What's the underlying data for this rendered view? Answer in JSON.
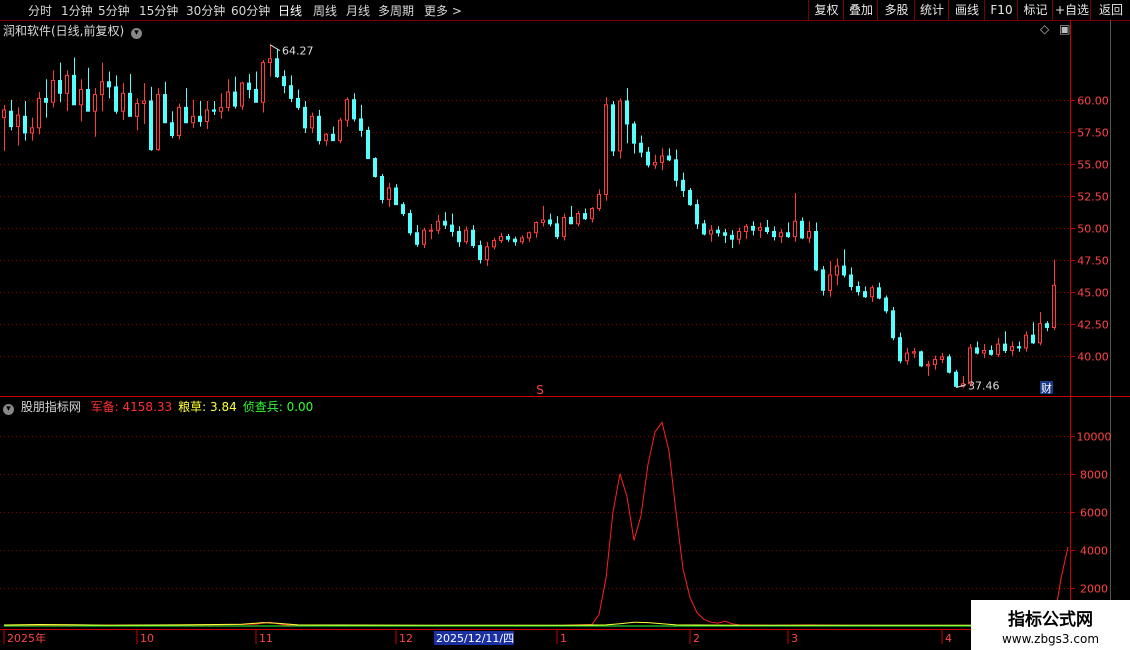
{
  "toolbar": {
    "periods": [
      "分时",
      "1分钟",
      "5分钟",
      "15分钟",
      "30分钟",
      "60分钟",
      "日线",
      "周线",
      "月线",
      "多周期",
      "更多"
    ],
    "active_period": "日线",
    "right_buttons": [
      "复权",
      "叠加",
      "多股",
      "统计",
      "画线",
      "F10",
      "标记",
      "+自选",
      "返回"
    ]
  },
  "chart_title": "润和软件(日线,前复权)",
  "indicator": {
    "name": "股朋指标网",
    "labels": [
      {
        "text": "军备: 4158.33",
        "color": "#ff3030"
      },
      {
        "text": "粮草: 3.84",
        "color": "#ffff3c"
      },
      {
        "text": "侦查兵: 0.00",
        "color": "#30ff30"
      }
    ]
  },
  "markers": {
    "high_label": "64.27",
    "low_label": "37.46",
    "s_mark": "S",
    "cai_mark": "财"
  },
  "watermark": {
    "line1": "指标公式网",
    "line2": "www.zbgs3.com"
  },
  "colors": {
    "up": "#ff3b3b",
    "down": "#54ffff",
    "grid": "#8a0000",
    "axis": "#cc0000",
    "indicator": "#ff2020"
  },
  "chart_data": [
    {
      "type": "candlestick",
      "title": "润和软件(日线,前复权)",
      "y_ticks": [
        40.0,
        42.5,
        45.0,
        47.5,
        50.0,
        52.5,
        55.0,
        57.5,
        60.0
      ],
      "ylim": [
        37.0,
        64.9
      ],
      "x_ticks": [
        {
          "label": "2025年",
          "index": 0
        },
        {
          "label": "10",
          "index": 19
        },
        {
          "label": "11",
          "index": 36
        },
        {
          "label": "12",
          "index": 56
        },
        {
          "label": "2025/12/11/四",
          "index": 64
        },
        {
          "label": "1",
          "index": 79
        },
        {
          "label": "2",
          "index": 98
        },
        {
          "label": "3",
          "index": 112
        },
        {
          "label": "4",
          "index": 134
        }
      ],
      "ohlc": [
        [
          58.6,
          59.6,
          56.0,
          59.2
        ],
        [
          59.1,
          60.0,
          57.6,
          57.9
        ],
        [
          57.9,
          59.4,
          56.4,
          58.8
        ],
        [
          58.7,
          59.9,
          56.8,
          57.4
        ],
        [
          57.4,
          58.6,
          56.8,
          57.8
        ],
        [
          57.8,
          60.6,
          57.3,
          60.1
        ],
        [
          60.1,
          61.6,
          58.6,
          59.8
        ],
        [
          59.8,
          62.3,
          59.4,
          61.5
        ],
        [
          61.5,
          62.9,
          59.8,
          60.5
        ],
        [
          60.5,
          62.3,
          59.1,
          61.9
        ],
        [
          61.9,
          63.3,
          59.8,
          59.6
        ],
        [
          59.6,
          61.6,
          58.3,
          60.8
        ],
        [
          60.8,
          62.5,
          59.6,
          59.1
        ],
        [
          59.1,
          60.9,
          57.1,
          60.4
        ],
        [
          60.4,
          62.9,
          59.1,
          61.4
        ],
        [
          61.4,
          62.2,
          60.1,
          61.0
        ],
        [
          61.0,
          61.9,
          58.9,
          59.1
        ],
        [
          59.1,
          61.3,
          58.4,
          60.5
        ],
        [
          60.5,
          62.0,
          59.3,
          58.7
        ],
        [
          58.7,
          60.1,
          57.6,
          59.7
        ],
        [
          59.7,
          61.3,
          58.1,
          59.9
        ],
        [
          59.9,
          61.0,
          56.0,
          56.1
        ],
        [
          56.1,
          60.9,
          56.0,
          60.4
        ],
        [
          60.4,
          61.4,
          58.6,
          58.2
        ],
        [
          58.2,
          59.1,
          57.0,
          57.2
        ],
        [
          57.2,
          59.7,
          56.9,
          59.4
        ],
        [
          59.4,
          60.9,
          58.6,
          58.2
        ],
        [
          58.2,
          60.0,
          57.8,
          58.7
        ],
        [
          58.7,
          59.9,
          57.9,
          58.3
        ],
        [
          58.3,
          59.9,
          57.7,
          59.2
        ],
        [
          59.2,
          59.9,
          58.8,
          59.1
        ],
        [
          59.1,
          60.5,
          58.5,
          59.4
        ],
        [
          59.4,
          61.6,
          59.1,
          60.6
        ],
        [
          60.6,
          61.8,
          59.3,
          59.5
        ],
        [
          59.5,
          61.4,
          59.2,
          61.3
        ],
        [
          61.3,
          62.0,
          60.1,
          60.8
        ],
        [
          60.8,
          62.2,
          60.1,
          59.8
        ],
        [
          59.8,
          63.1,
          59.0,
          62.9
        ],
        [
          62.9,
          64.3,
          61.8,
          63.2
        ],
        [
          63.2,
          64.0,
          61.7,
          61.8
        ],
        [
          61.8,
          62.3,
          60.5,
          61.1
        ],
        [
          61.1,
          61.9,
          59.8,
          60.1
        ],
        [
          60.1,
          60.8,
          59.2,
          59.4
        ],
        [
          59.4,
          59.9,
          57.4,
          57.8
        ],
        [
          57.8,
          59.0,
          57.4,
          58.7
        ],
        [
          58.7,
          59.2,
          56.5,
          56.8
        ],
        [
          56.8,
          57.4,
          56.4,
          57.3
        ],
        [
          57.3,
          57.9,
          56.8,
          56.8
        ],
        [
          56.8,
          58.6,
          56.6,
          58.4
        ],
        [
          58.4,
          60.2,
          57.9,
          60.0
        ],
        [
          60.0,
          60.5,
          58.3,
          58.5
        ],
        [
          58.5,
          59.6,
          57.1,
          57.6
        ],
        [
          57.6,
          57.9,
          55.4,
          55.4
        ],
        [
          55.4,
          55.5,
          53.9,
          54.0
        ],
        [
          54.0,
          54.2,
          51.9,
          52.2
        ],
        [
          52.2,
          53.5,
          51.6,
          53.1
        ],
        [
          53.1,
          53.4,
          51.8,
          51.8
        ],
        [
          51.8,
          52.0,
          50.9,
          51.1
        ],
        [
          51.1,
          51.4,
          49.4,
          49.6
        ],
        [
          49.6,
          50.2,
          48.5,
          48.7
        ],
        [
          48.7,
          50.0,
          48.4,
          49.8
        ],
        [
          49.8,
          50.3,
          49.1,
          49.8
        ],
        [
          49.8,
          51.0,
          49.5,
          50.5
        ],
        [
          50.5,
          51.2,
          49.9,
          50.2
        ],
        [
          50.2,
          51.1,
          49.3,
          49.7
        ],
        [
          49.7,
          50.1,
          48.5,
          48.9
        ],
        [
          48.9,
          50.1,
          48.7,
          49.8
        ],
        [
          49.8,
          50.2,
          48.4,
          48.6
        ],
        [
          48.6,
          49.0,
          47.2,
          47.5
        ],
        [
          47.5,
          48.9,
          47.0,
          48.5
        ],
        [
          48.5,
          49.2,
          48.3,
          49.0
        ],
        [
          49.0,
          49.6,
          48.8,
          49.3
        ],
        [
          49.3,
          49.5,
          48.9,
          49.1
        ],
        [
          49.1,
          49.3,
          48.6,
          48.9
        ],
        [
          48.9,
          49.4,
          48.7,
          49.2
        ],
        [
          49.2,
          49.7,
          48.9,
          49.6
        ],
        [
          49.6,
          50.5,
          49.2,
          50.4
        ],
        [
          50.4,
          51.7,
          50.1,
          50.6
        ],
        [
          50.6,
          51.1,
          50.1,
          50.3
        ],
        [
          50.3,
          50.9,
          49.1,
          49.3
        ],
        [
          49.3,
          51.1,
          49.0,
          50.8
        ],
        [
          50.8,
          51.7,
          50.3,
          50.3
        ],
        [
          50.3,
          51.3,
          50.1,
          51.1
        ],
        [
          51.1,
          51.5,
          50.6,
          50.7
        ],
        [
          50.7,
          51.6,
          50.4,
          51.5
        ],
        [
          51.5,
          53.0,
          51.3,
          52.6
        ],
        [
          52.6,
          60.2,
          52.1,
          59.6
        ],
        [
          59.6,
          59.9,
          55.6,
          56.0
        ],
        [
          56.0,
          60.1,
          55.4,
          59.9
        ],
        [
          59.9,
          60.9,
          56.6,
          58.1
        ],
        [
          58.1,
          58.3,
          55.8,
          56.6
        ],
        [
          56.6,
          57.2,
          55.5,
          55.9
        ],
        [
          55.9,
          56.3,
          54.7,
          54.9
        ],
        [
          54.9,
          55.7,
          54.6,
          55.1
        ],
        [
          55.1,
          56.2,
          54.5,
          55.6
        ],
        [
          55.6,
          56.2,
          55.2,
          55.3
        ],
        [
          55.3,
          56.1,
          53.2,
          53.7
        ],
        [
          53.7,
          54.3,
          52.4,
          52.9
        ],
        [
          52.9,
          53.1,
          51.7,
          51.8
        ],
        [
          51.8,
          52.2,
          49.9,
          50.3
        ],
        [
          50.3,
          50.6,
          49.4,
          49.5
        ],
        [
          49.5,
          50.2,
          48.9,
          49.8
        ],
        [
          49.8,
          50.1,
          49.3,
          49.6
        ],
        [
          49.6,
          49.9,
          48.8,
          49.4
        ],
        [
          49.4,
          49.8,
          48.4,
          49.1
        ],
        [
          49.1,
          50.0,
          48.7,
          49.7
        ],
        [
          49.7,
          50.3,
          49.1,
          50.1
        ],
        [
          50.1,
          50.5,
          49.4,
          49.8
        ],
        [
          49.8,
          50.4,
          49.2,
          50.0
        ],
        [
          50.0,
          50.6,
          49.5,
          49.7
        ],
        [
          49.7,
          50.1,
          49.0,
          49.3
        ],
        [
          49.3,
          49.9,
          48.8,
          49.6
        ],
        [
          49.6,
          50.4,
          49.2,
          49.3
        ],
        [
          49.3,
          52.7,
          48.9,
          50.5
        ],
        [
          50.5,
          50.8,
          49.1,
          49.2
        ],
        [
          49.2,
          50.5,
          48.8,
          49.7
        ],
        [
          49.7,
          50.4,
          46.6,
          46.7
        ],
        [
          46.7,
          47.0,
          44.7,
          45.1
        ],
        [
          45.1,
          47.4,
          44.6,
          46.3
        ],
        [
          46.3,
          47.6,
          45.5,
          47.0
        ],
        [
          47.0,
          48.3,
          46.1,
          46.3
        ],
        [
          46.3,
          46.9,
          45.1,
          45.4
        ],
        [
          45.4,
          45.8,
          44.7,
          45.0
        ],
        [
          45.0,
          45.4,
          44.5,
          44.6
        ],
        [
          44.6,
          45.5,
          44.2,
          45.3
        ],
        [
          45.3,
          45.7,
          44.4,
          44.5
        ],
        [
          44.5,
          44.7,
          43.3,
          43.5
        ],
        [
          43.5,
          43.8,
          41.2,
          41.4
        ],
        [
          41.4,
          41.8,
          39.4,
          39.6
        ],
        [
          39.6,
          40.6,
          39.3,
          40.2
        ],
        [
          40.2,
          40.6,
          39.8,
          40.3
        ],
        [
          40.3,
          40.4,
          39.1,
          39.2
        ],
        [
          39.2,
          39.6,
          38.4,
          39.3
        ],
        [
          39.3,
          40.0,
          38.9,
          39.7
        ],
        [
          39.7,
          40.2,
          39.4,
          39.9
        ],
        [
          39.9,
          40.1,
          38.6,
          38.7
        ],
        [
          38.7,
          38.9,
          37.5,
          37.6
        ],
        [
          37.6,
          38.4,
          37.5,
          37.8
        ],
        [
          37.8,
          40.9,
          37.6,
          40.6
        ],
        [
          40.6,
          41.1,
          40.1,
          40.2
        ],
        [
          40.2,
          40.9,
          39.8,
          40.4
        ],
        [
          40.4,
          40.8,
          40.0,
          40.1
        ],
        [
          40.1,
          41.4,
          39.9,
          40.9
        ],
        [
          40.9,
          41.9,
          40.2,
          40.4
        ],
        [
          40.4,
          41.1,
          40.0,
          40.7
        ],
        [
          40.7,
          41.1,
          40.3,
          40.6
        ],
        [
          40.6,
          41.9,
          40.3,
          41.6
        ],
        [
          41.6,
          42.6,
          40.9,
          41.0
        ],
        [
          41.0,
          43.4,
          40.8,
          42.5
        ],
        [
          42.5,
          42.7,
          41.9,
          42.2
        ],
        [
          42.2,
          47.5,
          42.0,
          45.5
        ]
      ]
    },
    {
      "type": "line",
      "title": "股朋指标网",
      "y_ticks": [
        2000,
        4000,
        6000,
        8000,
        10000
      ],
      "ylim": [
        0,
        11300
      ],
      "series": [
        {
          "name": "军备",
          "color": "#ff2020",
          "points": [
            [
              0,
              30
            ],
            [
              10,
              40
            ],
            [
              20,
              50
            ],
            [
              30,
              60
            ],
            [
              36,
              100
            ],
            [
              38,
              200
            ],
            [
              40,
              60
            ],
            [
              50,
              40
            ],
            [
              60,
              30
            ],
            [
              70,
              30
            ],
            [
              80,
              40
            ],
            [
              84,
              80
            ],
            [
              85,
              600
            ],
            [
              86,
              2500
            ],
            [
              87,
              6000
            ],
            [
              88,
              8000
            ],
            [
              89,
              6800
            ],
            [
              90,
              4500
            ],
            [
              91,
              5800
            ],
            [
              92,
              8500
            ],
            [
              93,
              10200
            ],
            [
              94,
              10700
            ],
            [
              95,
              9200
            ],
            [
              96,
              6000
            ],
            [
              97,
              3000
            ],
            [
              98,
              1500
            ],
            [
              99,
              700
            ],
            [
              100,
              350
            ],
            [
              101,
              200
            ],
            [
              102,
              150
            ],
            [
              103,
              250
            ],
            [
              104,
              120
            ],
            [
              105,
              60
            ],
            [
              110,
              40
            ],
            [
              115,
              60
            ],
            [
              120,
              40
            ],
            [
              130,
              30
            ],
            [
              140,
              30
            ],
            [
              148,
              40
            ],
            [
              150,
              250
            ],
            [
              151,
              2500
            ],
            [
              152,
              4158.33
            ]
          ]
        },
        {
          "name": "粮草",
          "color": "#ffff3c",
          "points": [
            [
              0,
              50
            ],
            [
              5,
              80
            ],
            [
              10,
              70
            ],
            [
              15,
              40
            ],
            [
              25,
              60
            ],
            [
              34,
              90
            ],
            [
              37,
              180
            ],
            [
              39,
              140
            ],
            [
              42,
              60
            ],
            [
              60,
              40
            ],
            [
              80,
              40
            ],
            [
              86,
              60
            ],
            [
              88,
              120
            ],
            [
              90,
              200
            ],
            [
              92,
              180
            ],
            [
              94,
              120
            ],
            [
              96,
              60
            ],
            [
              105,
              40
            ],
            [
              120,
              40
            ],
            [
              140,
              40
            ],
            [
              152,
              60
            ]
          ]
        },
        {
          "name": "侦查兵",
          "color": "#30ff30",
          "points": [
            [
              0,
              0
            ],
            [
              152,
              0
            ]
          ]
        }
      ]
    }
  ]
}
